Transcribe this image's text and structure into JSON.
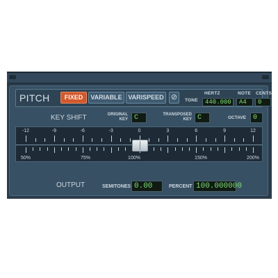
{
  "title": "PITCH",
  "modes": [
    {
      "label": "FIXED",
      "active": true
    },
    {
      "label": "VARIABLE",
      "active": false
    },
    {
      "label": "VARISPEED",
      "active": false
    }
  ],
  "null_symbol": "⊘",
  "tone": {
    "label": "TONE",
    "hertz_label": "HERTZ",
    "hertz": "440.000",
    "note_label": "NOTE",
    "note": "A4",
    "cents_label": "CENTS",
    "cents": "0"
  },
  "key_shift": {
    "label": "KEY SHIFT",
    "original_label_1": "ORIGINAL",
    "original_label_2": "KEY",
    "original": "C",
    "transposed_label_1": "TRANSPOSED",
    "transposed_label_2": "KEY",
    "transposed": "C",
    "octave_label": "OCTAVE",
    "octave": "0"
  },
  "slider": {
    "semitone_ticks": [
      "-12",
      "-9",
      "-6",
      "-3",
      "0",
      "3",
      "6",
      "9",
      "12"
    ],
    "percent_ticks": [
      "50%",
      "75%",
      "100%",
      "150%",
      "200%"
    ],
    "value_semitones": 0
  },
  "output": {
    "label": "OUTPUT",
    "semitones_label": "SEMITONES",
    "semitones": "0.00",
    "percent_label": "PERCENT",
    "percent": "100.000000"
  },
  "colors": {
    "active_mode": "#d2582d",
    "display_text": "#7fe07a",
    "panel": "#385063"
  }
}
